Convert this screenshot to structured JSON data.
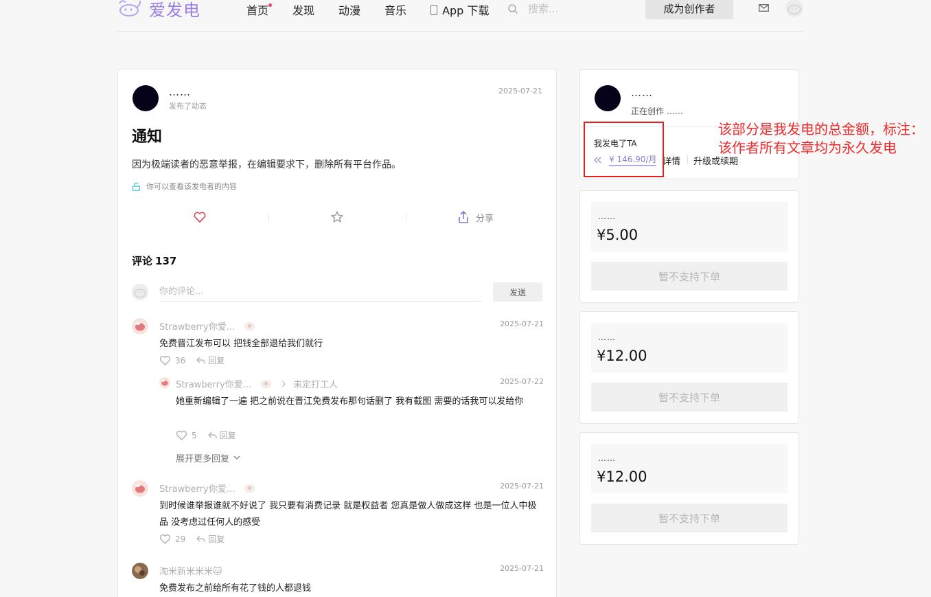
{
  "header": {
    "logo_text": "爱发电",
    "nav": [
      {
        "label": "首页",
        "has_dot": true
      },
      {
        "label": "发现"
      },
      {
        "label": "动漫"
      },
      {
        "label": "音乐"
      },
      {
        "label": "App 下载"
      }
    ],
    "search_placeholder": "搜索...",
    "become_creator": "成为创作者"
  },
  "post": {
    "author_name": "……",
    "action": "发布了动态",
    "date": "2025-07-21",
    "title": "通知",
    "content": "因为极端读者的恶意举报，在编辑要求下，删除所有平台作品。",
    "access_note": "你可以查看该发电者的内容",
    "share_label": "分享"
  },
  "comments_section": {
    "label": "评论",
    "count": "137",
    "input_placeholder": "你的评论...",
    "send_label": "发送"
  },
  "comments": [
    {
      "name": "Strawberry你爱...",
      "date": "2025-07-21",
      "text": "免费晋江发布可以 把钱全部退给我们就行",
      "likes": "36",
      "reply_label": "回复"
    },
    {
      "name": "Strawberry你爱...",
      "reply_to": "未定打工人",
      "date": "2025-07-22",
      "text": "她重新编辑了一遍 把之前说在晋江免费发布那句话删了 我有截图 需要的话我可以发给你",
      "likes": "5",
      "reply_label": "回复",
      "expand_label": "展开更多回复"
    },
    {
      "name": "Strawberry你爱...",
      "date": "2025-07-21",
      "text": "到时候谁举报谁就不好说了 我只要有消费记录 就是权益者 您真是做人做成这样 也是一位人中极品 没考虑过任何人的感受",
      "likes": "29",
      "reply_label": "回复"
    },
    {
      "name": "淘米新米米米🐱",
      "date": "2025-07-21",
      "text": "免费发布之前给所有花了钱的人都退钱"
    }
  ],
  "profile": {
    "name": "……",
    "status": "正在创作 ……",
    "sponsor_label": "我发电了TA",
    "sponsor_amount": "¥ 146.90/月",
    "detail_label": "详情",
    "renew_label": "升级或续期"
  },
  "tiers": [
    {
      "name": "……",
      "price": "¥5.00",
      "button": "暂不支持下单"
    },
    {
      "name": "……",
      "price": "¥12.00",
      "button": "暂不支持下单"
    },
    {
      "name": "……",
      "price": "¥12.00",
      "button": "暂不支持下单"
    }
  ],
  "annotation": {
    "text": "该部分是我发电的总金额，标注：该作者所有文章均为永久发电",
    "color": "#ee2a2a"
  },
  "colors": {
    "brand": "#9b7fe6",
    "notice_dot": "#e0465a",
    "like_heart": "#e0465a",
    "share_icon": "#8b6fd8"
  }
}
